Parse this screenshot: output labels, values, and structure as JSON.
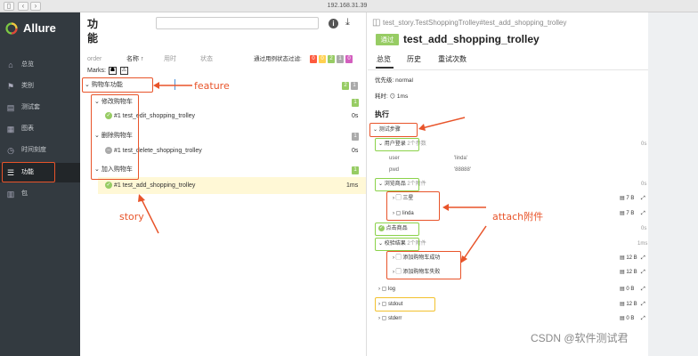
{
  "browser": {
    "url": "192.168.31.39"
  },
  "brand": {
    "name": "Allure"
  },
  "sidebar": {
    "items": [
      {
        "label": "总览",
        "icon": "home-icon"
      },
      {
        "label": "类别",
        "icon": "flag-icon"
      },
      {
        "label": "测试套",
        "icon": "briefcase-icon"
      },
      {
        "label": "图表",
        "icon": "chart-icon"
      },
      {
        "label": "时间刻度",
        "icon": "clock-icon"
      },
      {
        "label": "功能",
        "icon": "list-icon"
      },
      {
        "label": "包",
        "icon": "package-icon"
      }
    ]
  },
  "mid": {
    "title": "功能",
    "sort": {
      "order": "order",
      "name": "名称",
      "duration": "用时",
      "status": "状态"
    },
    "filter_label": "通过用例状态过滤:",
    "status_counts": [
      "0",
      "0",
      "2",
      "1",
      "0"
    ],
    "marks_label": "Marks:",
    "feature": {
      "label": "购物车功能",
      "badge_pass": "2",
      "badge_skip": "1"
    },
    "stories": [
      {
        "label": "修改购物车",
        "badge": "1",
        "test": "#1  test_edit_shopping_trolley",
        "dur": "0s"
      },
      {
        "label": "删除购物车",
        "badge": "1",
        "test": "#1  test_delete_shopping_trolley",
        "dur": "0s"
      },
      {
        "label": "加入购物车",
        "badge": "1",
        "test": "#1  test_add_shopping_trolley",
        "dur": "1ms"
      }
    ]
  },
  "annotations": {
    "feature": "feature",
    "story": "story",
    "attach": "attach附件"
  },
  "right": {
    "breadcrumb": "test_story.TestShoppingTrolley#test_add_shopping_trolley",
    "status_badge": "通过",
    "test_title": "test_add_shopping_trolley",
    "tabs": [
      "总览",
      "历史",
      "重试次数"
    ],
    "priority": "优先级: normal",
    "duration": "耗时: ⊙ 1ms",
    "exec": "执行",
    "steps_label": "测试步骤",
    "step1": {
      "label": "用户登录",
      "params": "2个参数",
      "dur": "0s"
    },
    "params": [
      {
        "k": "user",
        "v": "'linda'"
      },
      {
        "k": "pwd",
        "v": "'88888'"
      }
    ],
    "step2": {
      "label": "浏览商品",
      "attach": "2个附件",
      "dur": "0s"
    },
    "attachments1": [
      {
        "name": "三星",
        "size": "7 B"
      },
      {
        "name": "linda",
        "size": "7 B"
      }
    ],
    "step3": {
      "label": "点击商品",
      "dur": "0s"
    },
    "step4": {
      "label": "校验结果",
      "attach": "2个附件",
      "dur": "1ms"
    },
    "attachments2": [
      {
        "name": "添加购物车成功",
        "size": "12 B"
      },
      {
        "name": "添加购物车失败",
        "size": "12 B"
      }
    ],
    "logs": [
      {
        "name": "log",
        "size": "0 B"
      },
      {
        "name": "stdout",
        "size": "12 B"
      },
      {
        "name": "stderr",
        "size": "0 B"
      }
    ]
  },
  "watermark": "CSDN @软件测试君",
  "colors": {
    "sidebar": "#333a40",
    "passed": "#97cc64",
    "annotation": "#e8542a",
    "highlight": "#fff8d6"
  }
}
